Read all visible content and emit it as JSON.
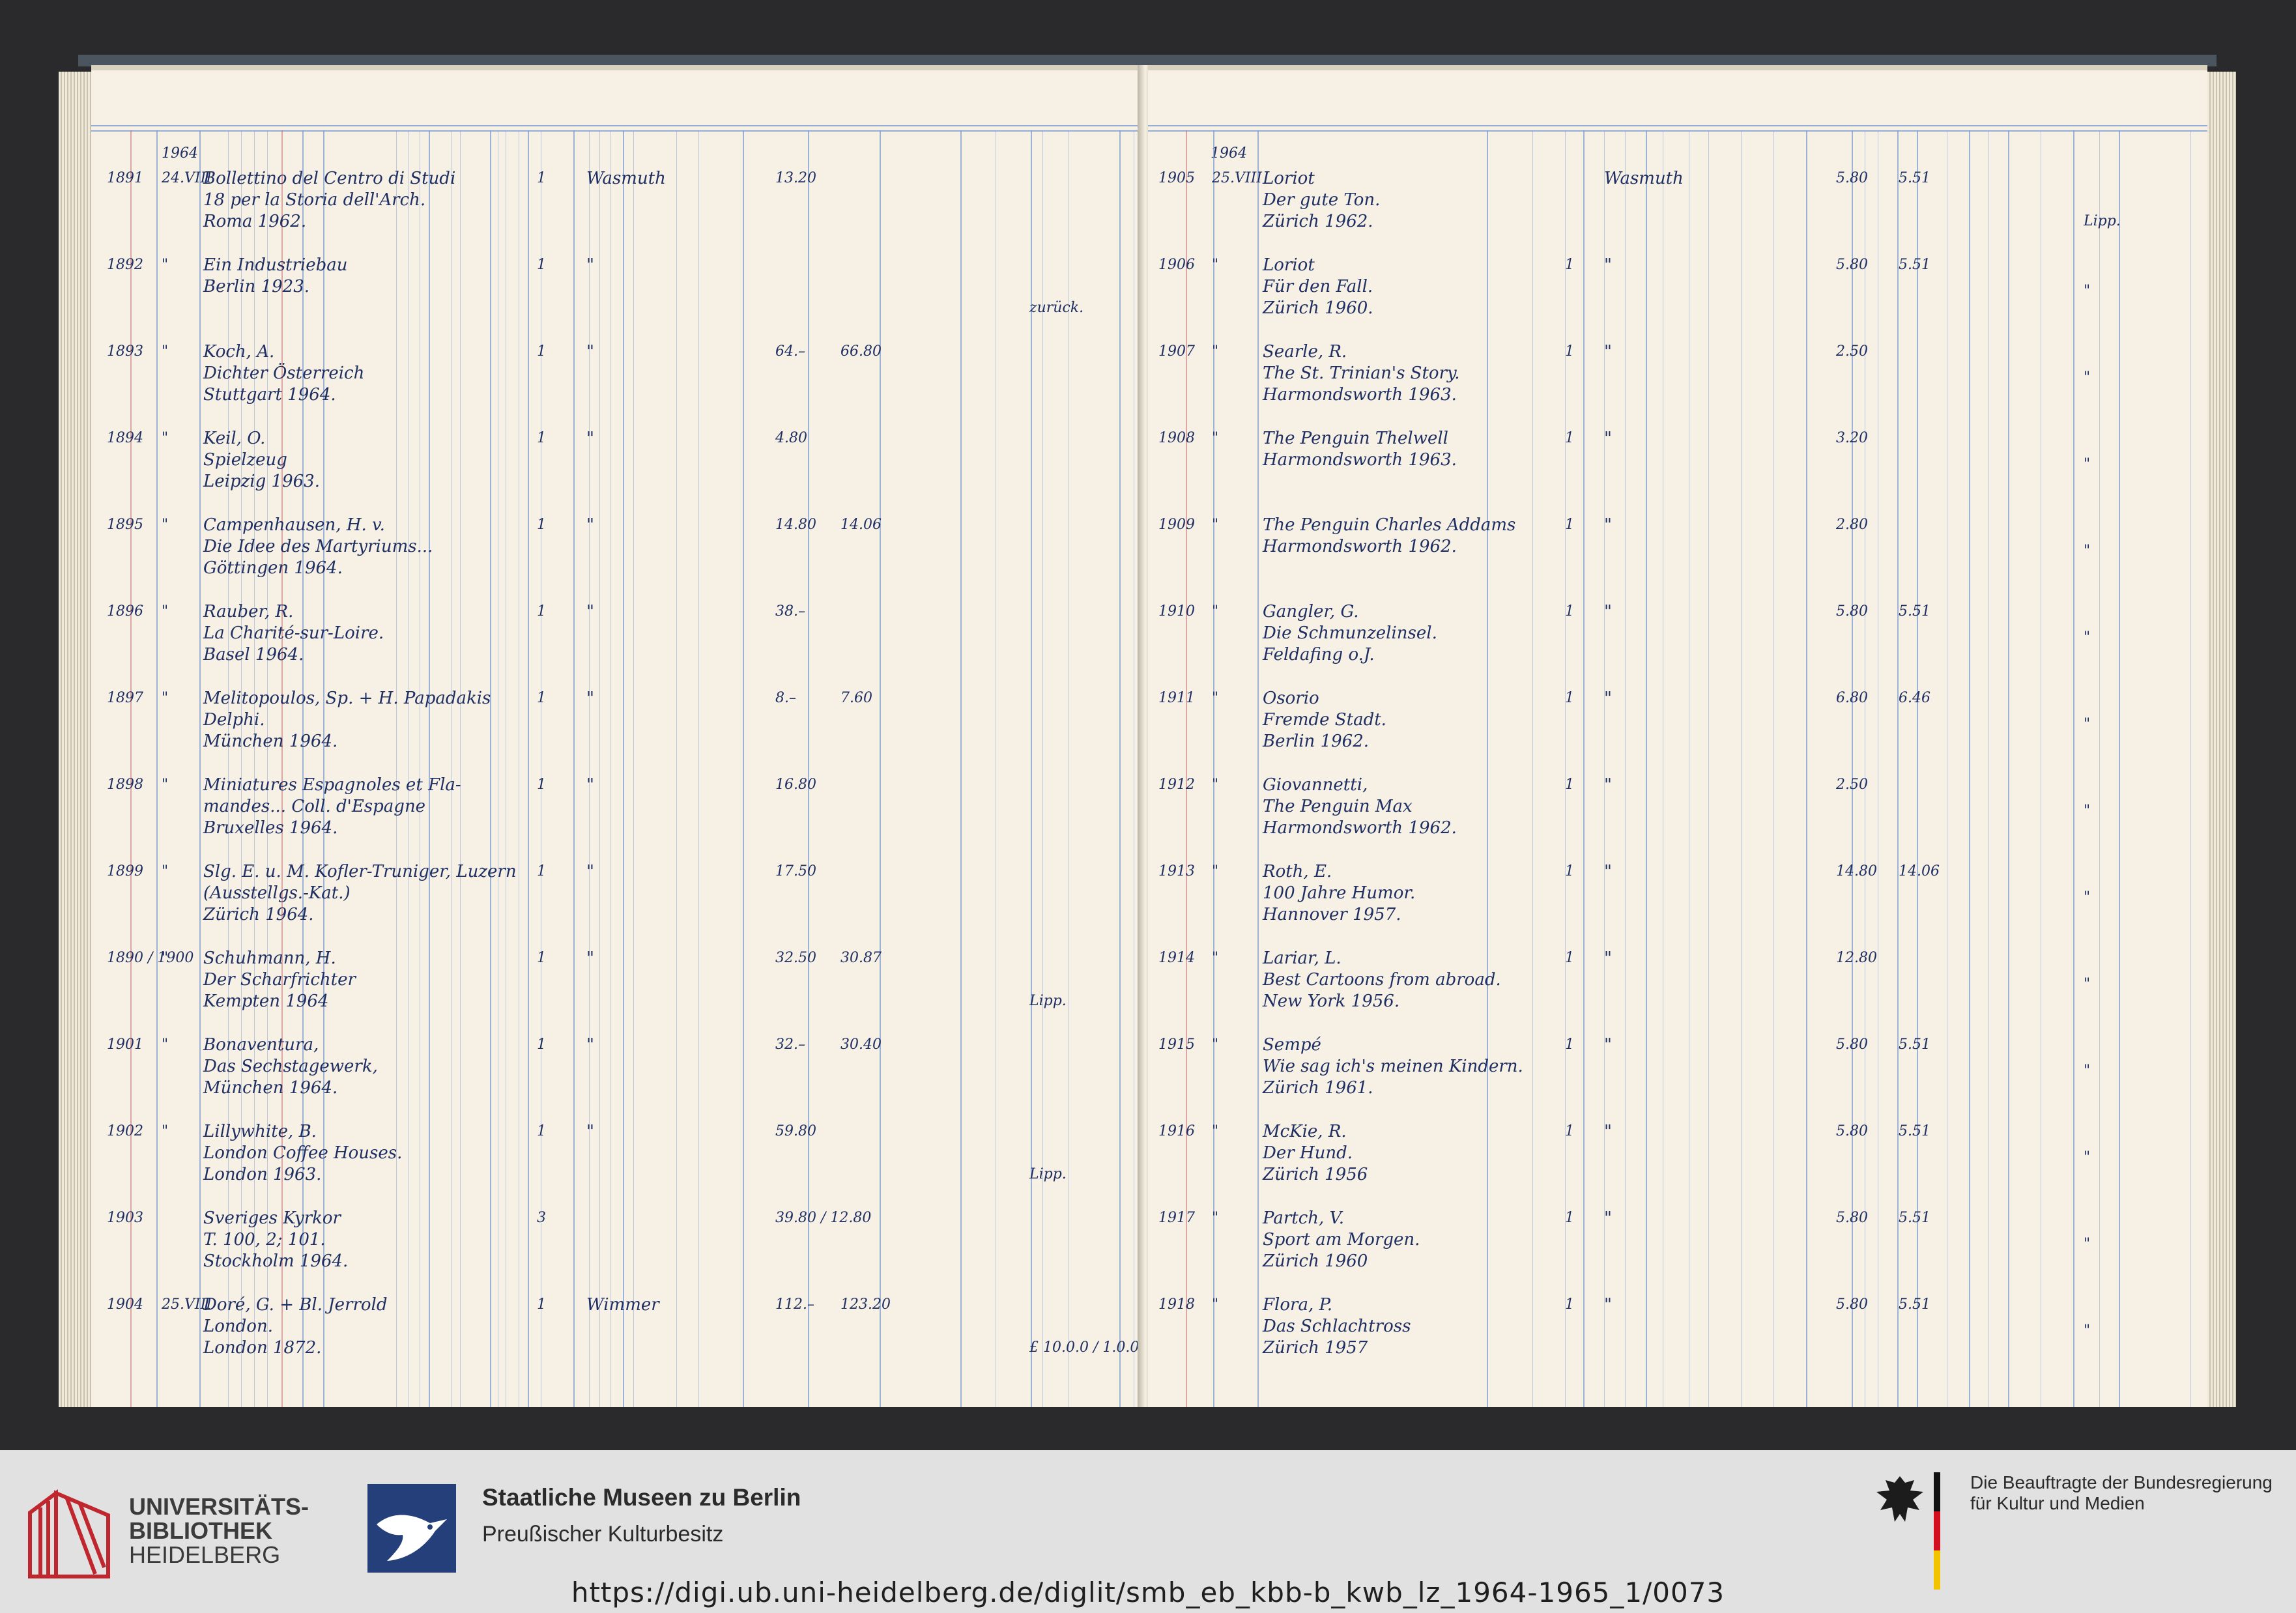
{
  "ledger": {
    "left": {
      "year_header": "1964",
      "entries": [
        {
          "no": "1891",
          "date": "24.VIII",
          "lines": [
            "Bollettino del Centro di Studi",
            "18            per la Storia dell'Arch.",
            "Roma 1962."
          ],
          "qty": "1",
          "supplier": "Wasmuth",
          "price": "13.20",
          "price2": "",
          "note": ""
        },
        {
          "no": "1892",
          "date": "\"",
          "lines": [
            "Ein Industriebau",
            "Berlin 1923."
          ],
          "qty": "1",
          "supplier": "\"",
          "price": "",
          "price2": "",
          "note": "zurück."
        },
        {
          "no": "1893",
          "date": "\"",
          "lines": [
            "Koch, A.",
            "Dichter Österreich",
            "Stuttgart 1964."
          ],
          "qty": "1",
          "supplier": "\"",
          "price": "64.–",
          "price2": "66.80",
          "note": ""
        },
        {
          "no": "1894",
          "date": "\"",
          "lines": [
            "Keil, O.",
            "Spielzeug",
            "Leipzig 1963."
          ],
          "qty": "1",
          "supplier": "\"",
          "price": "4.80",
          "price2": "",
          "note": ""
        },
        {
          "no": "1895",
          "date": "\"",
          "lines": [
            "Campenhausen, H. v.",
            "Die Idee des Martyriums...",
            "Göttingen 1964."
          ],
          "qty": "1",
          "supplier": "\"",
          "price": "14.80",
          "price2": "14.06",
          "note": ""
        },
        {
          "no": "1896",
          "date": "\"",
          "lines": [
            "Rauber, R.",
            "La Charité-sur-Loire.",
            "Basel 1964."
          ],
          "qty": "1",
          "supplier": "\"",
          "price": "38.–",
          "price2": "",
          "note": ""
        },
        {
          "no": "1897",
          "date": "\"",
          "lines": [
            "Melitopoulos, Sp. + H. Papadakis",
            "Delphi.",
            "München 1964."
          ],
          "qty": "1",
          "supplier": "\"",
          "price": "8.–",
          "price2": "7.60",
          "note": ""
        },
        {
          "no": "1898",
          "date": "\"",
          "lines": [
            "Miniatures Espagnoles et Fla-",
            "mandes... Coll. d'Espagne",
            "Bruxelles 1964."
          ],
          "qty": "1",
          "supplier": "\"",
          "price": "16.80",
          "price2": "",
          "note": ""
        },
        {
          "no": "1899",
          "date": "\"",
          "lines": [
            "Slg. E. u. M. Kofler-Truniger, Luzern",
            "(Ausstellgs.-Kat.)",
            "Zürich 1964."
          ],
          "qty": "1",
          "supplier": "\"",
          "price": "17.50",
          "price2": "",
          "note": ""
        },
        {
          "no": "1890 / 1900",
          "date": "\"",
          "lines": [
            "Schuhmann, H.",
            "Der Scharfrichter",
            "Kempten 1964"
          ],
          "qty": "1",
          "supplier": "\"",
          "price": "32.50",
          "price2": "30.87",
          "note": "Lipp."
        },
        {
          "no": "1901",
          "date": "\"",
          "lines": [
            "Bonaventura,",
            "Das Sechstagewerk,",
            "München 1964."
          ],
          "qty": "1",
          "supplier": "\"",
          "price": "32.–",
          "price2": "30.40",
          "note": ""
        },
        {
          "no": "1902",
          "date": "\"",
          "lines": [
            "Lillywhite, B.",
            "London Coffee Houses.",
            "London 1963."
          ],
          "qty": "1",
          "supplier": "\"",
          "price": "59.80",
          "price2": "",
          "note": "Lipp."
        },
        {
          "no": "1903",
          "date": "",
          "lines": [
            "Sveriges Kyrkor",
            "T. 100, 2; 101.",
            "Stockholm 1964."
          ],
          "qty": "3",
          "supplier": "",
          "price": "39.80 / 12.80",
          "price2": "",
          "note": ""
        },
        {
          "no": "1904",
          "date": "25.VIII",
          "lines": [
            "Doré, G. + Bl. Jerrold",
            "London.",
            "London 1872."
          ],
          "qty": "1",
          "supplier": "Wimmer",
          "price": "112.–",
          "price2": "123.20",
          "note": "£ 10.0.0 / 1.0.0."
        }
      ]
    },
    "right": {
      "year_header": "1964",
      "entries": [
        {
          "no": "1905",
          "date": "25.VIII",
          "lines": [
            "Loriot",
            "Der gute Ton.",
            "Zürich 1962."
          ],
          "qty": "",
          "supplier": "Wasmuth",
          "price": "5.80",
          "price2": "5.51",
          "note": "Lipp."
        },
        {
          "no": "1906",
          "date": "\"",
          "lines": [
            "Loriot",
            "Für den Fall.",
            "Zürich 1960."
          ],
          "qty": "1",
          "supplier": "\"",
          "price": "5.80",
          "price2": "5.51",
          "note": "\""
        },
        {
          "no": "1907",
          "date": "\"",
          "lines": [
            "Searle, R.",
            "The St. Trinian's Story.",
            "Harmondsworth 1963."
          ],
          "qty": "1",
          "supplier": "\"",
          "price": "2.50",
          "price2": "",
          "note": "\""
        },
        {
          "no": "1908",
          "date": "\"",
          "lines": [
            "The Penguin Thelwell",
            "Harmondsworth 1963."
          ],
          "qty": "1",
          "supplier": "\"",
          "price": "3.20",
          "price2": "",
          "note": "\""
        },
        {
          "no": "1909",
          "date": "\"",
          "lines": [
            "The Penguin Charles Addams",
            "Harmondsworth 1962."
          ],
          "qty": "1",
          "supplier": "\"",
          "price": "2.80",
          "price2": "",
          "note": "\""
        },
        {
          "no": "1910",
          "date": "\"",
          "lines": [
            "Gangler, G.",
            "Die Schmunzelinsel.",
            "Feldafing o.J."
          ],
          "qty": "1",
          "supplier": "\"",
          "price": "5.80",
          "price2": "5.51",
          "note": "\""
        },
        {
          "no": "1911",
          "date": "\"",
          "lines": [
            "Osorio",
            "Fremde Stadt.",
            "Berlin 1962."
          ],
          "qty": "1",
          "supplier": "\"",
          "price": "6.80",
          "price2": "6.46",
          "note": "\""
        },
        {
          "no": "1912",
          "date": "\"",
          "lines": [
            "Giovannetti,",
            "The Penguin Max",
            "Harmondsworth 1962."
          ],
          "qty": "1",
          "supplier": "\"",
          "price": "2.50",
          "price2": "",
          "note": "\""
        },
        {
          "no": "1913",
          "date": "\"",
          "lines": [
            "Roth, E.",
            "100 Jahre Humor.",
            "Hannover 1957."
          ],
          "qty": "1",
          "supplier": "\"",
          "price": "14.80",
          "price2": "14.06",
          "note": "\""
        },
        {
          "no": "1914",
          "date": "\"",
          "lines": [
            "Lariar, L.",
            "Best Cartoons from abroad.",
            "New York 1956."
          ],
          "qty": "1",
          "supplier": "\"",
          "price": "12.80",
          "price2": "",
          "note": "\""
        },
        {
          "no": "1915",
          "date": "\"",
          "lines": [
            "Sempé",
            "Wie sag ich's meinen Kindern.",
            "Zürich 1961."
          ],
          "qty": "1",
          "supplier": "\"",
          "price": "5.80",
          "price2": "5.51",
          "note": "\""
        },
        {
          "no": "1916",
          "date": "\"",
          "lines": [
            "McKie, R.",
            "Der Hund.",
            "Zürich 1956"
          ],
          "qty": "1",
          "supplier": "\"",
          "price": "5.80",
          "price2": "5.51",
          "note": "\""
        },
        {
          "no": "1917",
          "date": "\"",
          "lines": [
            "Partch, V.",
            "Sport am Morgen.",
            "Zürich 1960"
          ],
          "qty": "1",
          "supplier": "\"",
          "price": "5.80",
          "price2": "5.51",
          "note": "\""
        },
        {
          "no": "1918",
          "date": "\"",
          "lines": [
            "Flora, P.",
            "Das Schlachtross",
            "Zürich 1957"
          ],
          "qty": "1",
          "supplier": "\"",
          "price": "5.80",
          "price2": "5.51",
          "note": "\""
        }
      ]
    }
  },
  "footer": {
    "uni_line1": "UNIVERSITÄTS-",
    "uni_line2": "BIBLIOTHEK",
    "uni_line3": "HEIDELBERG",
    "smb_title": "Staatliche Museen zu Berlin",
    "smb_subtitle": "Preußischer Kulturbesitz",
    "bkm_line1": "Die Beauftragte der Bundesregierung",
    "bkm_line2": "für Kultur und Medien",
    "url": "https://digi.ub.uni-heidelberg.de/diglit/smb_eb_kbb-b_kwb_lz_1964-1965_1/0073"
  },
  "colors": {
    "ink": "#1f2f63",
    "rule_blue": "#7d9ed3",
    "paper": "#f6f1e4",
    "footer_bg": "#e1e1e1",
    "uni_red": "#c0262d",
    "smb_blue": "#243f7a"
  }
}
